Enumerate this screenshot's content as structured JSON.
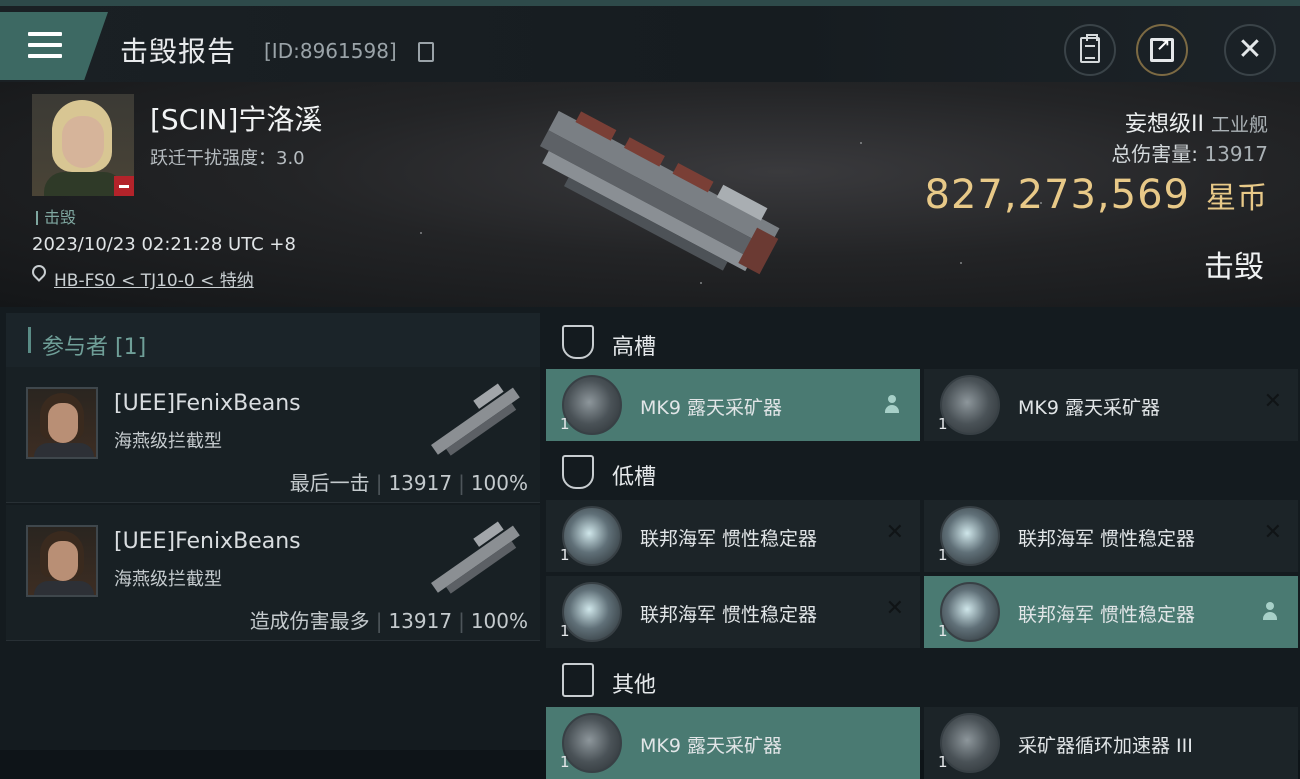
{
  "header": {
    "title": "击毁报告",
    "report_id": "[ID:8961598]"
  },
  "victim": {
    "name": "[SCIN]宁洛溪",
    "warp_label": "跃迁干扰强度：3.0",
    "status_tag": "击毁",
    "datetime": "2023/10/23 02:21:28 UTC +8",
    "location": "HB-FS0 < TJ10-0 < 特纳",
    "ship_name": "妄想级II",
    "ship_class": "工业舰",
    "total_damage_label": "总伤害量:",
    "total_damage_value": "13917",
    "isk_value": "827,273,569",
    "isk_unit": "星币",
    "result": "击毁"
  },
  "participants": {
    "header": "参与者 [1]",
    "items": [
      {
        "name": "[UEE]FenixBeans",
        "ship": "海燕级拦截型",
        "role": "最后一击",
        "damage": "13917",
        "percent": "100%"
      },
      {
        "name": "[UEE]FenixBeans",
        "ship": "海燕级拦截型",
        "role": "造成伤害最多",
        "damage": "13917",
        "percent": "100%"
      }
    ]
  },
  "fitting": {
    "high_slot": {
      "title": "高槽",
      "modules": [
        {
          "name": "MK9 露天采矿器",
          "qty": "1",
          "state": "dropped"
        },
        {
          "name": "MK9 露天采矿器",
          "qty": "1",
          "state": "destroyed"
        }
      ]
    },
    "low_slot": {
      "title": "低槽",
      "modules": [
        {
          "name": "联邦海军 惯性稳定器",
          "qty": "1",
          "state": "destroyed"
        },
        {
          "name": "联邦海军 惯性稳定器",
          "qty": "1",
          "state": "destroyed"
        },
        {
          "name": "联邦海军 惯性稳定器",
          "qty": "1",
          "state": "destroyed"
        },
        {
          "name": "联邦海军 惯性稳定器",
          "qty": "1",
          "state": "dropped"
        }
      ]
    },
    "other": {
      "title": "其他",
      "modules": [
        {
          "name": "MK9 露天采矿器",
          "qty": "1",
          "state": "dropped"
        },
        {
          "name": "采矿器循环加速器 III",
          "qty": "1",
          "state": "destroyed"
        }
      ]
    }
  },
  "icons": {
    "destroyed_mark": "✕",
    "menu": "menu-icon",
    "close": "✕"
  },
  "colors": {
    "accent": "#4a7a72",
    "isk": "#e8c988",
    "destroyed_badge": "#b3232a"
  }
}
